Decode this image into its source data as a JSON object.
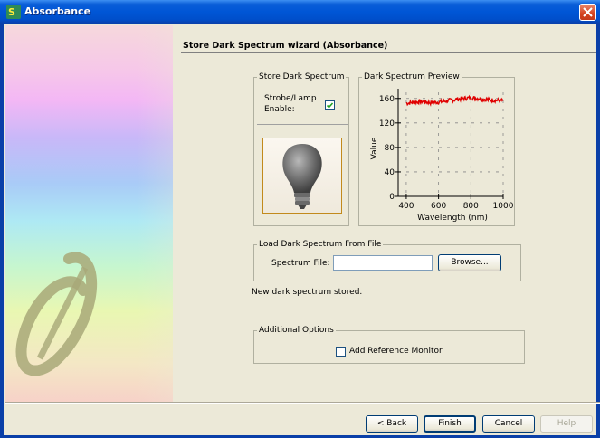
{
  "window": {
    "title": "Absorbance",
    "close_icon": "close-icon"
  },
  "wizard": {
    "title": "Store Dark Spectrum wizard (Absorbance)"
  },
  "store_dark": {
    "group_label": "Store Dark Spectrum",
    "strobe_label_line1": "Strobe/Lamp",
    "strobe_label_line2": "Enable:",
    "strobe_checked": true,
    "lamp_icon": "light-bulb-icon"
  },
  "preview": {
    "group_label": "Dark Spectrum Preview"
  },
  "load_file": {
    "group_label": "Load Dark Spectrum From File",
    "spectrum_file_label": "Spectrum File:",
    "spectrum_file_value": "",
    "browse_label": "Browse..."
  },
  "status_text": "New dark spectrum stored.",
  "additional": {
    "group_label": "Additional Options",
    "add_reference_label": "Add Reference Monitor",
    "add_reference_checked": false
  },
  "buttons": {
    "back": "< Back",
    "finish": "Finish",
    "cancel": "Cancel",
    "help": "Help"
  },
  "colors": {
    "trace": "#e00000",
    "title_bar": "#0056d6",
    "accent_border": "#c28a1c"
  },
  "chart_data": {
    "type": "line",
    "title": "",
    "xlabel": "Wavelength (nm)",
    "ylabel": "Value",
    "xlim": [
      350,
      1000
    ],
    "ylim": [
      0,
      170
    ],
    "xticks": [
      400,
      600,
      800,
      1000
    ],
    "yticks": [
      0,
      40,
      80,
      120,
      160
    ],
    "grid": true,
    "series": [
      {
        "x": [
          400,
          450,
          500,
          550,
          600,
          650,
          700,
          750,
          800,
          850,
          900,
          950,
          1000
        ],
        "values": [
          152,
          154,
          155,
          153,
          154,
          156,
          158,
          160,
          161,
          160,
          158,
          157,
          156
        ]
      }
    ]
  }
}
